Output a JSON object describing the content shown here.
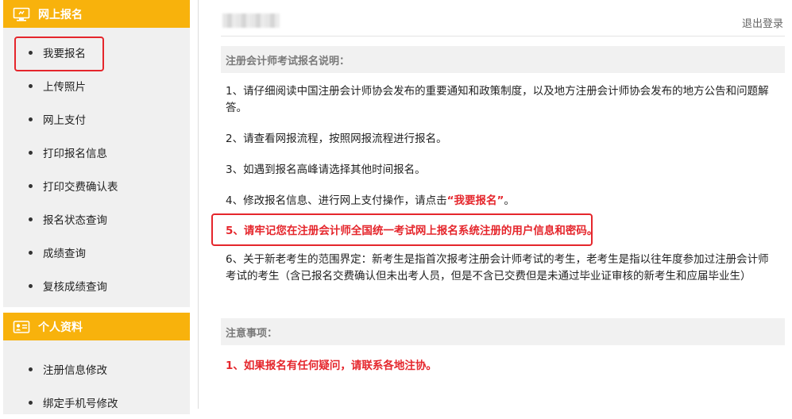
{
  "sidebar": {
    "online_registration": {
      "title": "网上报名",
      "icon": "monitor-icon",
      "items": [
        {
          "label": "我要报名"
        },
        {
          "label": "上传照片"
        },
        {
          "label": "网上支付"
        },
        {
          "label": "打印报名信息"
        },
        {
          "label": "打印交费确认表"
        },
        {
          "label": "报名状态查询"
        },
        {
          "label": "成绩查询"
        },
        {
          "label": "复核成绩查询"
        }
      ]
    },
    "personal_info": {
      "title": "个人资料",
      "icon": "id-card-icon",
      "items": [
        {
          "label": "注册信息修改"
        },
        {
          "label": "绑定手机号修改"
        }
      ]
    }
  },
  "header": {
    "logout_label": "退出登录"
  },
  "instructions": {
    "title": "注册会计师考试报名说明：",
    "items": [
      {
        "text": "1、请仔细阅读中国注册会计师协会发布的重要通知和政策制度，以及地方注册会计师协会发布的地方公告和问题解答。"
      },
      {
        "text": "2、请查看网报流程，按照网报流程进行报名。"
      },
      {
        "text": "3、如遇到报名高峰请选择其他时间报名。"
      },
      {
        "prefix": "4、修改报名信息、进行网上支付操作，请点击",
        "highlight": "“我要报名”",
        "suffix": "。"
      },
      {
        "prefix": "5、",
        "highlight": "请牢记您在注册会计师全国统一考试网上报名系统注册的用户信息和密码。"
      },
      {
        "text": "6、关于新老考生的范围界定：新考生是指首次报考注册会计师考试的考生，老考生是指以往年度参加过注册会计师考试的考生（含已报名交费确认但未出考人员，但是不含已交费但是未通过毕业证审核的新考生和应届毕业生）"
      }
    ]
  },
  "notes": {
    "title": "注意事项：",
    "items": [
      {
        "text": "1、如果报名有任何疑问，请联系各地注协。"
      }
    ]
  },
  "colors": {
    "accent": "#f8b20c",
    "highlight_red": "#e5262c",
    "sidebar_bg": "#f0f0f0"
  }
}
